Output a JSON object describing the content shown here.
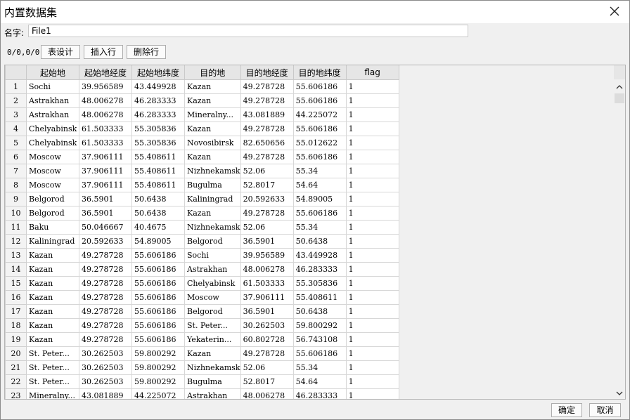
{
  "window": {
    "title": "内置数据集"
  },
  "name_field": {
    "label": "名字:",
    "value": "File1"
  },
  "toolbar": {
    "counter": "0/0,0/0",
    "table_design": "表设计",
    "insert_row": "插入行",
    "delete_row": "删除行"
  },
  "table": {
    "columns": [
      "起始地",
      "起始地经度",
      "起始地纬度",
      "目的地",
      "目的地经度",
      "目的地纬度",
      "flag"
    ],
    "rows": [
      [
        "1",
        "Sochi",
        "39.956589",
        "43.449928",
        "Kazan",
        "49.278728",
        "55.606186",
        "1"
      ],
      [
        "2",
        "Astrakhan",
        "48.006278",
        "46.283333",
        "Kazan",
        "49.278728",
        "55.606186",
        "1"
      ],
      [
        "3",
        "Astrakhan",
        "48.006278",
        "46.283333",
        "Mineralny...",
        "43.081889",
        "44.225072",
        "1"
      ],
      [
        "4",
        "Chelyabinsk",
        "61.503333",
        "55.305836",
        "Kazan",
        "49.278728",
        "55.606186",
        "1"
      ],
      [
        "5",
        "Chelyabinsk",
        "61.503333",
        "55.305836",
        "Novosibirsk",
        "82.650656",
        "55.012622",
        "1"
      ],
      [
        "6",
        "Moscow",
        "37.906111",
        "55.408611",
        "Kazan",
        "49.278728",
        "55.606186",
        "1"
      ],
      [
        "7",
        "Moscow",
        "37.906111",
        "55.408611",
        "Nizhnekamsk",
        "52.06",
        "55.34",
        "1"
      ],
      [
        "8",
        "Moscow",
        "37.906111",
        "55.408611",
        "Bugulma",
        "52.8017",
        "54.64",
        "1"
      ],
      [
        "9",
        "Belgorod",
        "36.5901",
        "50.6438",
        "Kaliningrad",
        "20.592633",
        "54.89005",
        "1"
      ],
      [
        "10",
        "Belgorod",
        "36.5901",
        "50.6438",
        "Kazan",
        "49.278728",
        "55.606186",
        "1"
      ],
      [
        "11",
        "Baku",
        "50.046667",
        "40.4675",
        "Nizhnekamsk",
        "52.06",
        "55.34",
        "1"
      ],
      [
        "12",
        "Kaliningrad",
        "20.592633",
        "54.89005",
        "Belgorod",
        "36.5901",
        "50.6438",
        "1"
      ],
      [
        "13",
        "Kazan",
        "49.278728",
        "55.606186",
        "Sochi",
        "39.956589",
        "43.449928",
        "1"
      ],
      [
        "14",
        "Kazan",
        "49.278728",
        "55.606186",
        "Astrakhan",
        "48.006278",
        "46.283333",
        "1"
      ],
      [
        "15",
        "Kazan",
        "49.278728",
        "55.606186",
        "Chelyabinsk",
        "61.503333",
        "55.305836",
        "1"
      ],
      [
        "16",
        "Kazan",
        "49.278728",
        "55.606186",
        "Moscow",
        "37.906111",
        "55.408611",
        "1"
      ],
      [
        "17",
        "Kazan",
        "49.278728",
        "55.606186",
        "Belgorod",
        "36.5901",
        "50.6438",
        "1"
      ],
      [
        "18",
        "Kazan",
        "49.278728",
        "55.606186",
        "St. Peter...",
        "30.262503",
        "59.800292",
        "1"
      ],
      [
        "19",
        "Kazan",
        "49.278728",
        "55.606186",
        "Yekaterin...",
        "60.802728",
        "56.743108",
        "1"
      ],
      [
        "20",
        "St. Peter...",
        "30.262503",
        "59.800292",
        "Kazan",
        "49.278728",
        "55.606186",
        "1"
      ],
      [
        "21",
        "St. Peter...",
        "30.262503",
        "59.800292",
        "Nizhnekamsk",
        "52.06",
        "55.34",
        "1"
      ],
      [
        "22",
        "St. Peter...",
        "30.262503",
        "59.800292",
        "Bugulma",
        "52.8017",
        "54.64",
        "1"
      ],
      [
        "23",
        "Mineralny...",
        "43.081889",
        "44.225072",
        "Astrakhan",
        "48.006278",
        "46.283333",
        "1"
      ]
    ]
  },
  "footer": {
    "ok": "确定",
    "cancel": "取消"
  },
  "icons": {
    "close": "close-icon",
    "scroll_up": "chevron-up-icon",
    "scroll_down": "chevron-down-icon"
  }
}
